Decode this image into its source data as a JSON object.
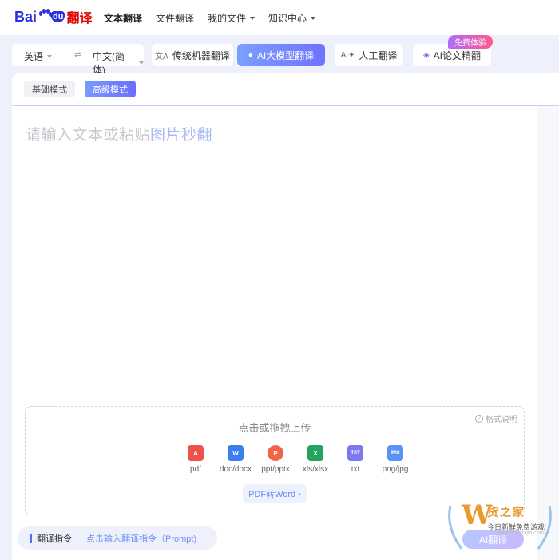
{
  "header": {
    "logo": {
      "bai": "Bai",
      "du": "du",
      "fy": "翻译"
    },
    "nav": [
      {
        "label": "文本翻译",
        "active": true,
        "dropdown": false
      },
      {
        "label": "文件翻译",
        "active": false,
        "dropdown": false
      },
      {
        "label": "我的文件",
        "active": false,
        "dropdown": true
      },
      {
        "label": "知识中心",
        "active": false,
        "dropdown": true
      }
    ]
  },
  "toolbar": {
    "source_lang": "英语",
    "swap_symbol": "⇌",
    "target_lang": "中文(简体)",
    "modes": [
      {
        "label": "传统机器翻译",
        "icon": "translate-icon"
      },
      {
        "label": "AI大模型翻译",
        "icon": "ai-sphere-icon",
        "active": true
      },
      {
        "label": "人工翻译",
        "icon": "ai-spark-icon"
      },
      {
        "label": "AI论文精翻",
        "icon": "layers-icon"
      }
    ],
    "badge": "免费体验"
  },
  "panel": {
    "subtabs": [
      {
        "label": "基础模式",
        "active": false
      },
      {
        "label": "高级模式",
        "active": true
      }
    ],
    "placeholder": {
      "text": "请输入文本或粘贴",
      "link": "图片秒翻"
    },
    "upload": {
      "format_note": "格式说明",
      "title": "点击或拖拽上传",
      "files": [
        {
          "label": "pdf",
          "color": "#f0504a",
          "glyph": "A"
        },
        {
          "label": "doc/docx",
          "color": "#3c7ef0",
          "glyph": "W"
        },
        {
          "label": "ppt/pptx",
          "color": "#f26448",
          "glyph": "P"
        },
        {
          "label": "xls/xlsx",
          "color": "#22a45a",
          "glyph": "X"
        },
        {
          "label": "txt",
          "color": "#7d78f2",
          "glyph": "TXT"
        },
        {
          "label": "png/jpg",
          "color": "#5a92f5",
          "glyph": "IMG"
        }
      ],
      "pdf_to_word": "PDF转Word ›"
    },
    "prompt": {
      "label": "翻译指令",
      "hint": "点击输入翻译指令（Prompt)"
    },
    "ai_button": "AI翻译"
  },
  "watermark": {
    "w": "W",
    "t1": "货之家",
    "t2": "今日新鲜免费游戏",
    "t3": "www.huozhijia.com"
  }
}
